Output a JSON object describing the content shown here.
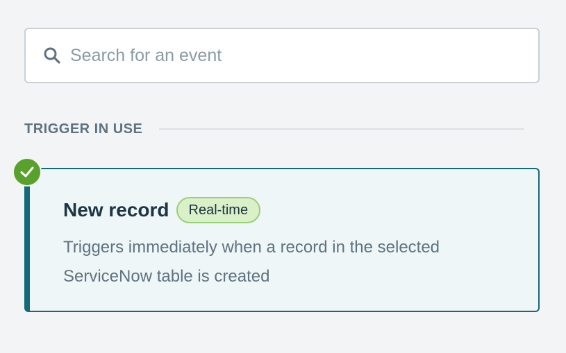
{
  "search": {
    "placeholder": "Search for an event",
    "value": ""
  },
  "section": {
    "title": "TRIGGER IN USE"
  },
  "trigger": {
    "title": "New record",
    "badge": "Real-time",
    "description": "Triggers immediately when a record in the selected ServiceNow table is created",
    "selected": true,
    "status_icon": "check-icon"
  },
  "colors": {
    "accent": "#146a76",
    "success": "#58a12b",
    "badge_bg": "#d9f0c9",
    "badge_border": "#9ad074",
    "card_bg": "#eef6f8"
  }
}
